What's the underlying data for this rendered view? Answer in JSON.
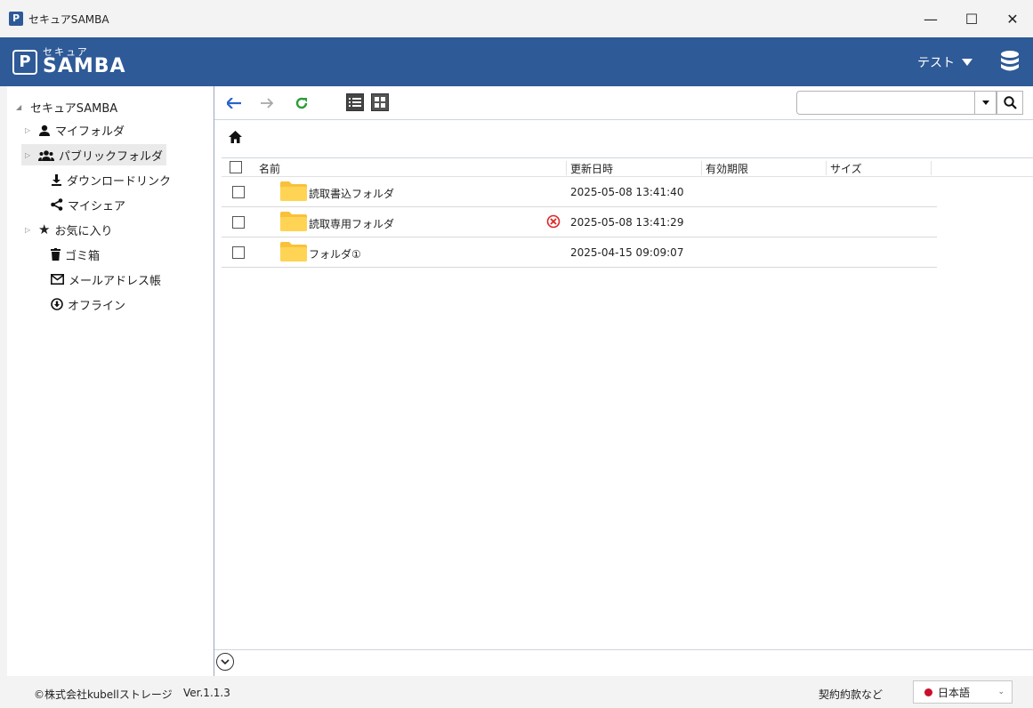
{
  "window": {
    "title": "セキュアSAMBA",
    "minimize": "—",
    "maximize": "☐",
    "close": "✕"
  },
  "banner": {
    "logo_small": "セキュア",
    "logo_big": "SAMBA",
    "user_label": "テスト"
  },
  "sidebar": {
    "root_label": "セキュアSAMBA",
    "items": [
      {
        "label": "マイフォルダ",
        "icon": "user-icon"
      },
      {
        "label": "パブリックフォルダ",
        "icon": "group-icon"
      },
      {
        "label": "ダウンロードリンク",
        "icon": "download-icon"
      },
      {
        "label": "マイシェア",
        "icon": "share-icon"
      },
      {
        "label": "お気に入り",
        "icon": "star-icon"
      },
      {
        "label": "ゴミ箱",
        "icon": "trash-icon"
      },
      {
        "label": "メールアドレス帳",
        "icon": "mail-icon"
      },
      {
        "label": "オフライン",
        "icon": "offline-icon"
      }
    ]
  },
  "table": {
    "headers": {
      "name": "名前",
      "updated": "更新日時",
      "expiry": "有効期限",
      "size": "サイズ"
    },
    "rows": [
      {
        "name": "読取書込フォルダ",
        "updated": "2025-05-08 13:41:40"
      },
      {
        "name": "読取専用フォルダ",
        "updated": "2025-05-08 13:41:29"
      },
      {
        "name": "フォルダ①",
        "updated": "2025-04-15 09:09:07"
      }
    ]
  },
  "footer": {
    "copyright": "©株式会社kubellストレージ",
    "version": "Ver.1.1.3",
    "terms": "契約約款など",
    "language": "日本語"
  },
  "colors": {
    "brand": "#2e5a97",
    "back_arrow": "#2a63c9",
    "refresh": "#2a9d3a",
    "folder": "#f9c13a",
    "lock_badge": "#e02424"
  }
}
